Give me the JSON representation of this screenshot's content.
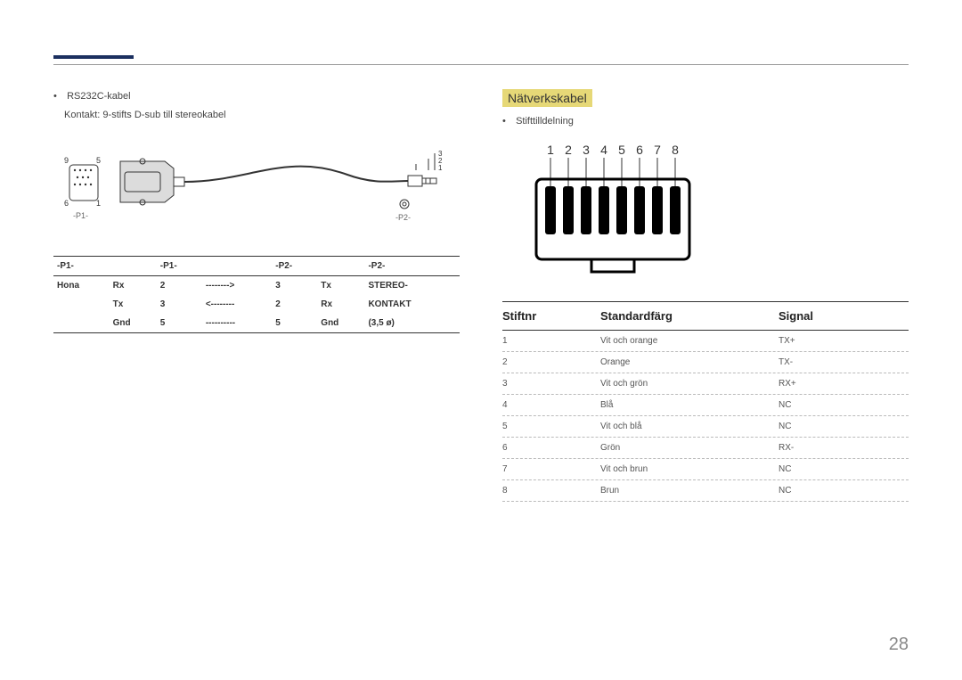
{
  "left": {
    "bullet1": "RS232C-kabel",
    "bullet2": "Kontakt: 9-stifts D-sub till stereokabel",
    "conn_labels": {
      "nine": "9",
      "five": "5",
      "six": "6",
      "one": "1",
      "p1": "-P1-",
      "p2": "-P2-",
      "l3": "3",
      "l2": "2",
      "l1": "1"
    },
    "table": {
      "hdr": [
        "-P1-",
        "",
        "-P1-",
        "",
        "-P2-",
        "",
        "-P2-"
      ],
      "rows": [
        [
          "Hona",
          "Rx",
          "2",
          "-------->",
          "3",
          "Tx",
          "STEREO-"
        ],
        [
          "",
          "Tx",
          "3",
          "<--------",
          "2",
          "Rx",
          "KONTAKT"
        ],
        [
          "",
          "Gnd",
          "5",
          "----------",
          "5",
          "Gnd",
          "(3,5 ø)"
        ]
      ]
    }
  },
  "right": {
    "title": "Nätverkskabel",
    "bullet": "Stifttilldelning",
    "pins": [
      "1",
      "2",
      "3",
      "4",
      "5",
      "6",
      "7",
      "8"
    ],
    "headers": [
      "Stiftnr",
      "Standardfärg",
      "Signal"
    ],
    "rows": [
      [
        "1",
        "Vit och orange",
        "TX+"
      ],
      [
        "2",
        "Orange",
        "TX-"
      ],
      [
        "3",
        "Vit och grön",
        "RX+"
      ],
      [
        "4",
        "Blå",
        "NC"
      ],
      [
        "5",
        "Vit och blå",
        "NC"
      ],
      [
        "6",
        "Grön",
        "RX-"
      ],
      [
        "7",
        "Vit och brun",
        "NC"
      ],
      [
        "8",
        "Brun",
        "NC"
      ]
    ]
  },
  "page": "28"
}
